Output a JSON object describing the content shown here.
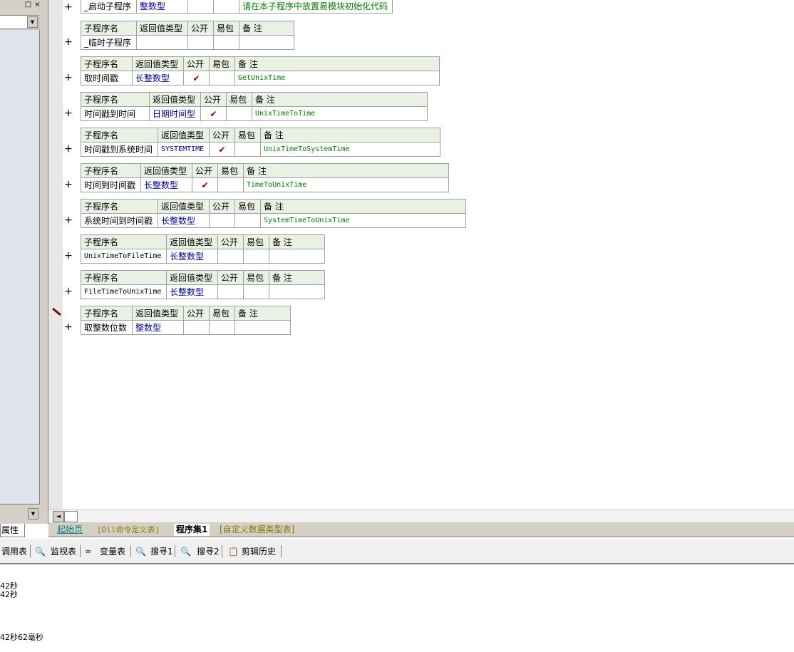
{
  "left_panel": {
    "max_icon": "□",
    "close_icon": "×",
    "combo_arrow": "▼",
    "scroll_arrow": "▼",
    "tab_label": "属性"
  },
  "editor": {
    "plus_symbol": "+",
    "top_partial": {
      "name": "_启动子程序",
      "return_type": "整数型",
      "note": "请在本子程序中放置易模块初始化代码"
    },
    "headers": {
      "name": "子程序名",
      "return_type": "返回值类型",
      "public": "公开",
      "easy_pack": "易包",
      "note": "备 注"
    },
    "check_mark": "✔",
    "subroutines": [
      {
        "name": "_临时子程序",
        "return_type": "",
        "public": "",
        "note": ""
      },
      {
        "name": "取时间戳",
        "return_type": "长整数型",
        "public": "✔",
        "note": "GetUnixTime"
      },
      {
        "name": "时间戳到时间",
        "return_type": "日期时间型",
        "public": "✔",
        "note": "UnixTimeToTime"
      },
      {
        "name": "时间戳到系统时间",
        "return_type": "SYSTEMTIME",
        "public": "✔",
        "note": "UnixTimeToSystemTime"
      },
      {
        "name": "时间到时间戳",
        "return_type": "长整数型",
        "public": "✔",
        "note": "TimeToUnixTime"
      },
      {
        "name": "系统时间到时间戳",
        "return_type": "长整数型",
        "public": "",
        "note": "SystemTimeToUnixTime"
      },
      {
        "name": "UnixTimeToFileTime",
        "return_type": "长整数型",
        "public": "",
        "note": ""
      },
      {
        "name": "FileTimeToUnixTime",
        "return_type": "长整数型",
        "public": "",
        "note": ""
      },
      {
        "name": "取整数位数",
        "return_type": "整数型",
        "public": "",
        "note": ""
      }
    ]
  },
  "scroll": {
    "left_arrow": "◄"
  },
  "tabs": [
    {
      "label": "起始页",
      "color": "#008080"
    },
    {
      "label": "[Dll命令定义表]",
      "color": "#808000"
    },
    {
      "label": "程序集1",
      "color": "#000000",
      "active": true
    },
    {
      "label": "[自定义数据类型表]",
      "color": "#808000"
    }
  ],
  "toolbar": {
    "call_table": "调用表",
    "monitor": "监视表",
    "variables": "变量表",
    "search1": "搜寻1",
    "search2": "搜寻2",
    "clip_history": "剪辑历史"
  },
  "output": {
    "lines": [
      "42秒",
      "42秒",
      "42秒62毫秒"
    ]
  }
}
